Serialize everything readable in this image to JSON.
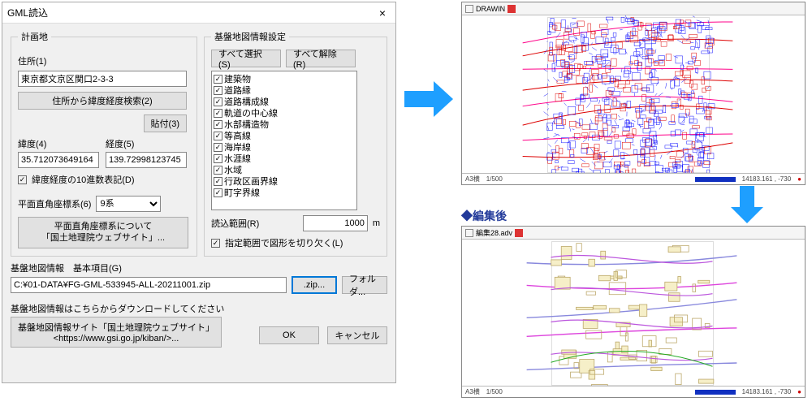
{
  "dialog": {
    "title": "GML読込",
    "close": "×",
    "plan_site": {
      "legend": "計画地"
    },
    "address": {
      "label": "住所(1)",
      "value": "東京都文京区関口2-3-3",
      "search_btn": "住所から緯度経度検索(2)",
      "paste_btn": "貼付(3)"
    },
    "coords": {
      "lat_label": "緯度(4)",
      "lat_value": "35.712073649164",
      "lon_label": "経度(5)",
      "lon_value": "139.72998123745",
      "decimal_label": "緯度経度の10進数表記(D)"
    },
    "crs": {
      "label": "平面直角座標系(6)",
      "value": "9系",
      "about_btn_line1": "平面直角座標系について",
      "about_btn_line2": "「国土地理院ウェブサイト」..."
    },
    "base": {
      "legend": "基盤地図情報設定",
      "select_all_btn": "すべて選択(S)",
      "clear_all_btn": "すべて解除(R)",
      "items": [
        {
          "label": "建築物",
          "checked": true
        },
        {
          "label": "道路縁",
          "checked": true
        },
        {
          "label": "道路構成線",
          "checked": true
        },
        {
          "label": "軌道の中心線",
          "checked": true
        },
        {
          "label": "水部構造物",
          "checked": true
        },
        {
          "label": "等高線",
          "checked": true
        },
        {
          "label": "海岸線",
          "checked": true
        },
        {
          "label": "水涯線",
          "checked": true
        },
        {
          "label": "水域",
          "checked": true
        },
        {
          "label": "行政区画界線",
          "checked": true
        },
        {
          "label": "町字界線",
          "checked": true
        }
      ],
      "range_label": "読込範囲(R)",
      "range_value": "1000",
      "range_unit": "m",
      "clip_label": "指定範囲で図形を切り欠く(L)"
    },
    "file": {
      "label": "基盤地図情報　基本項目(G)",
      "value": "C:¥01-DATA¥FG-GML-533945-ALL-20211001.zip",
      "zip_btn": ".zip...",
      "folder_btn": "フォルダ..."
    },
    "download": {
      "label": "基盤地図情報はこちらからダウンロードしてください",
      "site_btn_line1": "基盤地図情報サイト「国土地理院ウェブサイト」",
      "site_btn_line2": "<https://www.gsi.go.jp/kiban/>..."
    },
    "footer": {
      "ok": "OK",
      "cancel": "キャンセル"
    }
  },
  "preview": {
    "win1_title": "DRAWIN",
    "win2_title": "編集28.adv",
    "after_label": "◆編集後",
    "status_scale": "A3横",
    "status_scale2": "1/500",
    "status_coord": "14183.161 , -730"
  }
}
